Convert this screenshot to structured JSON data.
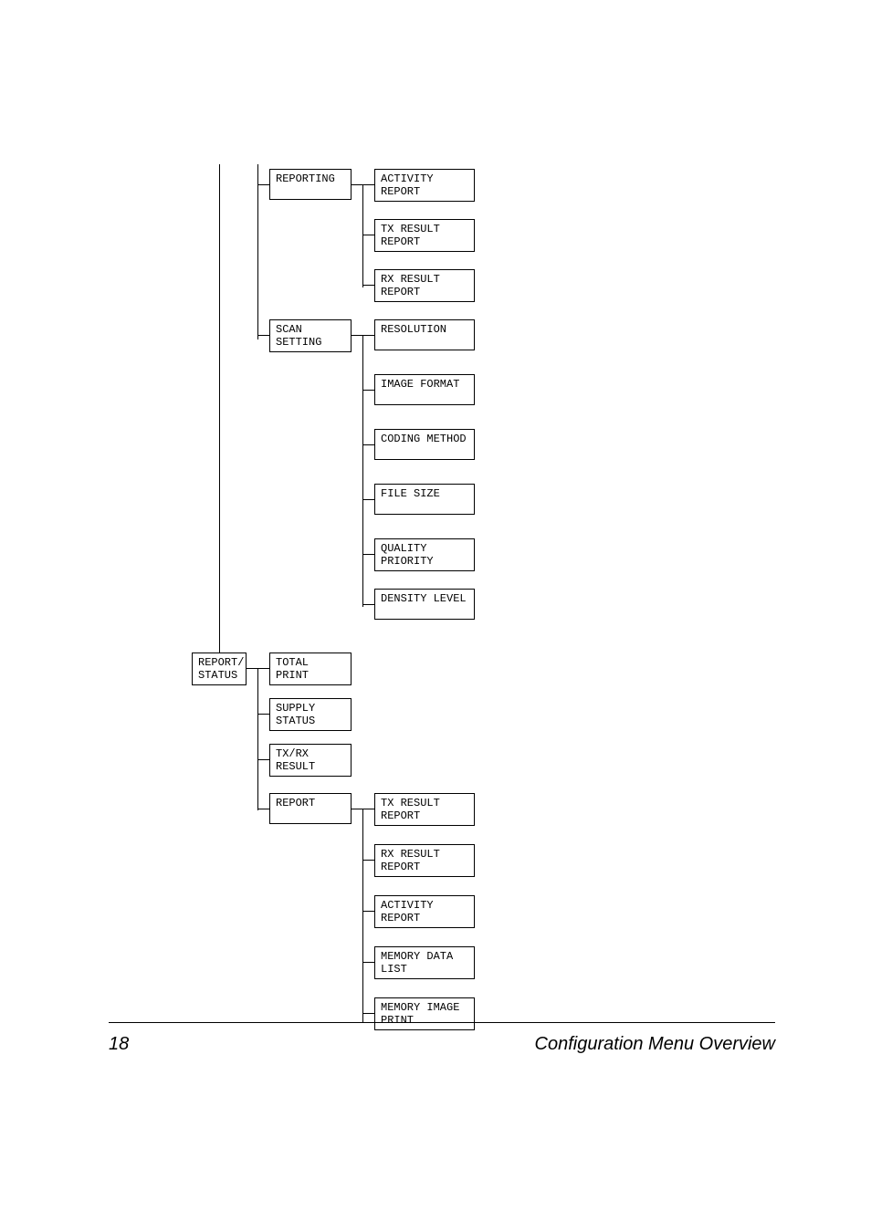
{
  "footer": {
    "page_number": "18",
    "title": "Configuration Menu Overview"
  },
  "tree": {
    "col1": {
      "report_status": "REPORT/\nSTATUS"
    },
    "col2": {
      "reporting": "REPORTING",
      "scan_setting": "SCAN\nSETTING",
      "total_print": "TOTAL\nPRINT",
      "supply_status": "SUPPLY\nSTATUS",
      "txrx_result": "TX/RX\nRESULT",
      "report": "REPORT"
    },
    "col3": {
      "activity_report": "ACTIVITY\nREPORT",
      "tx_result_report": "TX RESULT\nREPORT",
      "rx_result_report": "RX RESULT\nREPORT",
      "resolution": "RESOLUTION",
      "image_format": "IMAGE FORMAT",
      "coding_method": "CODING METHOD",
      "file_size": "FILE SIZE",
      "quality_priority": "QUALITY\nPRIORITY",
      "density_level": "DENSITY LEVEL",
      "tx_result_report2": "TX RESULT\nREPORT",
      "rx_result_report2": "RX RESULT\nREPORT",
      "activity_report2": "ACTIVITY\nREPORT",
      "memory_data_list": "MEMORY DATA\nLIST",
      "memory_image_print": "MEMORY IMAGE\nPRINT"
    }
  }
}
